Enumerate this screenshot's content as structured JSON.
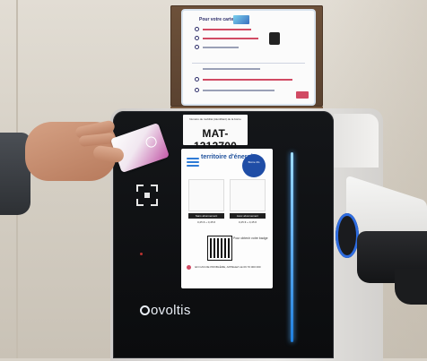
{
  "charger_label": {
    "small_text": "Numéro de mobilité (identifiant) de la borne",
    "id": "MAT-1312700"
  },
  "info_card": {
    "brand": "territoire d'énergie",
    "badge": "Borne 4G",
    "step1": "Sans abonnement",
    "step2": "Avec abonnement",
    "step1_price": "0,25 € + 0,45 €",
    "step2_price": "0,25 € + 0,45 €",
    "qr_note": "Pour obtenir votre badge",
    "footer": "EN CAS DE PROBLÈME, APPELEZ LE 09 70 000 000"
  },
  "top_sticker": {
    "title": "Pour votre carte RFID"
  },
  "panel_brand": "ovoltis",
  "colors": {
    "led": "#2f8cff",
    "panel": "#0d0e10",
    "card_accent": "#c35aa8"
  }
}
